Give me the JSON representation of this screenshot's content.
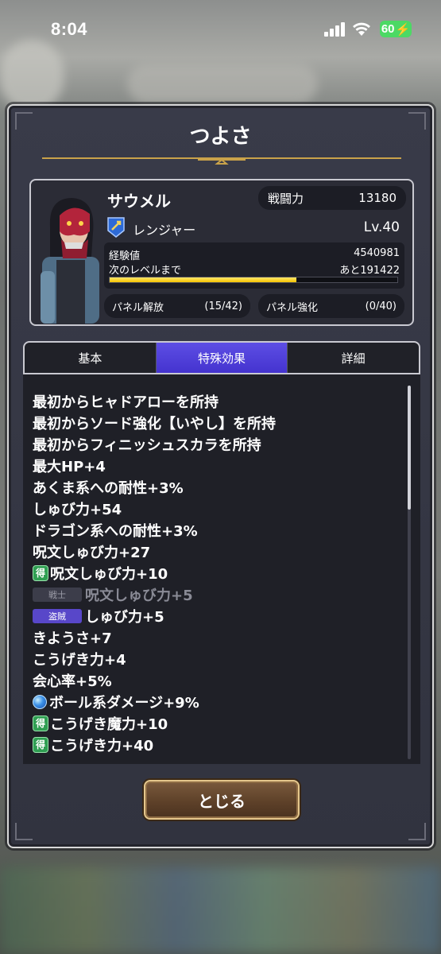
{
  "status_bar": {
    "time": "8:04",
    "battery": "60"
  },
  "dialog": {
    "title": "つよさ"
  },
  "character": {
    "name": "サウメル",
    "power_label": "戦闘力",
    "power_value": "13180",
    "job": "レンジャー",
    "level": "Lv.40",
    "exp_label": "経験値",
    "exp_value": "4540981",
    "next_label": "次のレベルまで",
    "next_value": "あと191422",
    "exp_progress": 0.65,
    "panel_open_label": "パネル解放",
    "panel_open_value": "(15/42)",
    "panel_strength_label": "パネル強化",
    "panel_strength_value": "(0/40)"
  },
  "tabs": [
    {
      "label": "基本",
      "active": false
    },
    {
      "label": "特殊効果",
      "active": true
    },
    {
      "label": "詳細",
      "active": false
    }
  ],
  "effects": [
    {
      "text": "最初からヒャドアローを所持"
    },
    {
      "text": "最初からソード強化【いやし】を所持"
    },
    {
      "text": "最初からフィニッシュスカラを所持"
    },
    {
      "text": "最大HP+4"
    },
    {
      "text": "あくま系への耐性+3%"
    },
    {
      "text": "しゅび力+54"
    },
    {
      "text": "ドラゴン系への耐性+3%"
    },
    {
      "text": "呪文しゅび力+27"
    },
    {
      "tag": "得",
      "text": "呪文しゅび力+10"
    },
    {
      "job_tag": "戦士",
      "text": "呪文しゅび力+5",
      "dim": true
    },
    {
      "job_tag": "盗賊",
      "text": "しゅび力+5"
    },
    {
      "text": "きようさ+7"
    },
    {
      "text": "こうげき力+4"
    },
    {
      "text": "会心率+5%"
    },
    {
      "icon": "orb",
      "text": "ボール系ダメージ+9%"
    },
    {
      "tag": "得",
      "text": "こうげき魔力+10"
    },
    {
      "tag": "得",
      "text": "こうげき力+40"
    }
  ],
  "buttons": {
    "close": "とじる"
  },
  "colors": {
    "active_tab": "#4f3fdc",
    "exp_bar": "#f5c400",
    "tag_green": "#2f9e52",
    "tag_purple": "#5847c9"
  }
}
